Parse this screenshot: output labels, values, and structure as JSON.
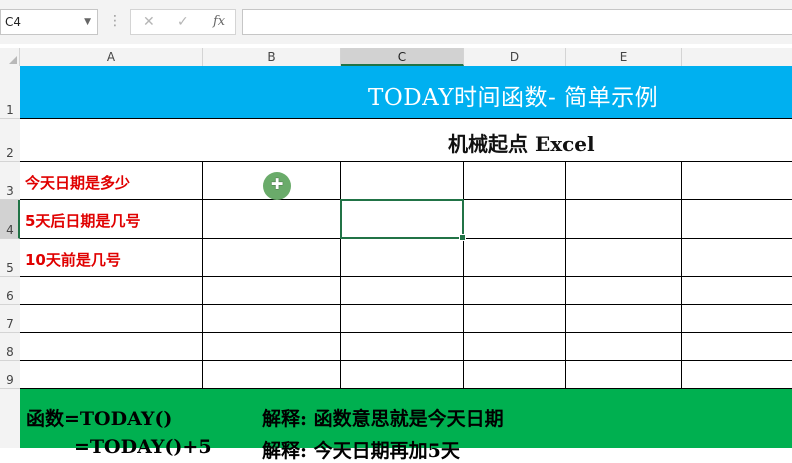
{
  "toolbar": {
    "name_box": "C4",
    "cancel_glyph": "✕",
    "enter_glyph": "✓",
    "fx_label": "fx",
    "formula": ""
  },
  "columns": [
    "A",
    "B",
    "C",
    "D",
    "E"
  ],
  "rows": [
    "1",
    "2",
    "3",
    "4",
    "5",
    "6",
    "7",
    "8",
    "9"
  ],
  "selected_cell": "C4",
  "sheet": {
    "title": "TODAY时间函数- 简单示例",
    "subtitle": "机械起点 Excel",
    "labels": [
      "今天日期是多少",
      "5天后日期是几号",
      "10天前是几号"
    ],
    "notes": [
      {
        "formula": "函数=TODAY()",
        "explain": "解释: 函数意思就是今天日期"
      },
      {
        "formula": "=TODAY()+5",
        "explain": "解释: 今天日期再加5天"
      }
    ]
  },
  "colors": {
    "title_band": "#00b0f0",
    "notes_band": "#00b050",
    "label_text": "#e00000",
    "selection": "#217346"
  },
  "icons": [
    "cancel-icon",
    "enter-icon",
    "fx-icon",
    "move-cursor-icon"
  ]
}
